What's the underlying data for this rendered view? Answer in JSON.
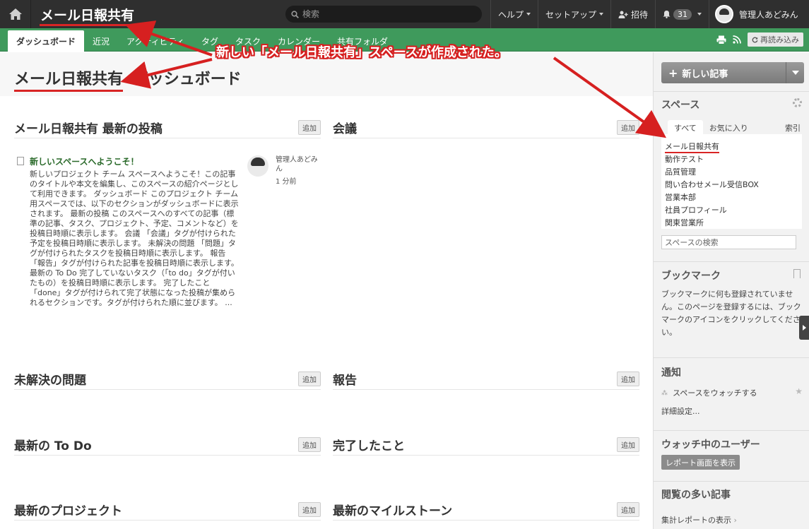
{
  "topbar": {
    "title": "メール日報共有",
    "search_placeholder": "検索",
    "menu": [
      {
        "label": "ヘルプ"
      },
      {
        "label": "セットアップ"
      },
      {
        "label": "招待"
      },
      {
        "label": "31"
      },
      {
        "label": "管理人あどみん"
      }
    ]
  },
  "tabs": [
    {
      "label": "ダッシュボード",
      "active": true
    },
    {
      "label": "近況"
    },
    {
      "label": "アクティビティ"
    },
    {
      "label": "タグ"
    },
    {
      "label": "タスク"
    },
    {
      "label": "カレンダー"
    },
    {
      "label": "共有フォルダ"
    }
  ],
  "tab_tools": {
    "reload_label": "再読み込み"
  },
  "page": {
    "space_name": "メール日報共有",
    "suffix": "ダッシュボード"
  },
  "sections": {
    "latest_posts": "メール日報共有 最新の投稿",
    "meetings": "会議",
    "open_issues": "未解決の問題",
    "reports": "報告",
    "latest_todo": "最新の To Do",
    "done": "完了したこと",
    "latest_projects": "最新のプロジェクト",
    "latest_milestones": "最新のマイルストーン",
    "add_label": "追加"
  },
  "post": {
    "title": "新しいスペースへようこそ！",
    "body": "新しいプロジェクト チーム スペースへようこそ！この記事のタイトルや本文を編集し、このスペースの紹介ページとして利用できます。 ダッシュボード このプロジェクト チーム用スペースでは、以下のセクションがダッシュボードに表示されます。 最新の投稿 このスペースへのすべての記事（標準の記事、タスク、プロジェクト、予定、コメントなど）を投稿日時順に表示します。 会議 「会議」タグが付けられた予定を投稿日時順に表示します。 未解決の問題 「問題」タグが付けられたタスクを投稿日時順に表示します。 報告 「報告」タグが付けられた記事を投稿日時順に表示します。 最新の To Do 完了していないタスク（「to do」タグが付いたもの）を投稿日時順に表示します。 完了したこと 「done」タグが付けられて完了状態になった投稿が集められるセクションです。タグが付けられた順に並びます。 ...",
    "author": "管理人あどみん",
    "time": "1 分前"
  },
  "sidebar": {
    "new_post_label": "新しい記事",
    "spaces_title": "スペース",
    "space_tabs": [
      "すべて",
      "お気に入り"
    ],
    "index_label": "索引",
    "spaces": [
      "メール日報共有",
      "動作テスト",
      "品質管理",
      "問い合わせメール受信BOX",
      "営業本部",
      "社員プロフィール",
      "関東営業所"
    ],
    "space_search_placeholder": "スペースの検索",
    "bookmarks_title": "ブックマーク",
    "bookmarks_text": "ブックマークに何も登録されていません。このページを登録するには、ブックマークのアイコンをクリックしてください。",
    "notify_title": "通知",
    "watch_label": "スペースをウォッチする",
    "detail_label": "詳細設定...",
    "watchers_title": "ウォッチ中のユーザー",
    "report_btn": "レポート画面を表示",
    "popular_title": "閲覧の多い記事",
    "report_link": "集計レポートの表示"
  },
  "annotation": {
    "text": "新しい「メール日報共有」スペースが作成された。",
    "color": "#d62020"
  },
  "colors": {
    "topbar": "#2f2f2f",
    "tabbar": "#3f9a5c",
    "accent_red": "#d82525"
  }
}
